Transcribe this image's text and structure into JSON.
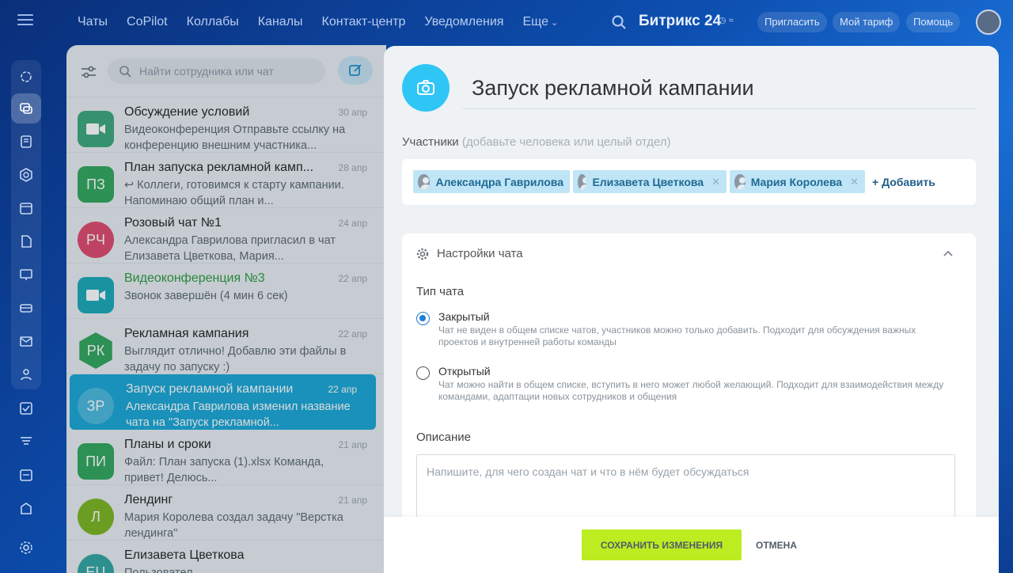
{
  "topbar": {
    "nav": [
      "Чаты",
      "CoPilot",
      "Коллабы",
      "Каналы",
      "Контакт-центр",
      "Уведомления",
      "Еще"
    ],
    "brand": "Битрикс 24",
    "buttons": [
      "Пригласить",
      "Мой тариф",
      "Помощь"
    ]
  },
  "rail": {
    "icons": [
      "copilot-icon",
      "chats-icon",
      "feed-icon",
      "collabs-icon",
      "calendar-icon",
      "documents-icon",
      "boards-icon",
      "drive-icon",
      "mail-icon",
      "groups-icon",
      "tasks-icon",
      "crm-icon",
      "planner-icon",
      "store-icon",
      "settings-icon"
    ]
  },
  "chatlist": {
    "search_placeholder": "Найти сотрудника или чат",
    "items": [
      {
        "title": "Обсуждение условий",
        "date": "30 апр",
        "text": "Видеоконференция Отправьте ссылку на конференцию внешним участника...",
        "ava": "",
        "color": "#3aa67a"
      },
      {
        "title": "План запуска рекламной камп...",
        "date": "28 апр",
        "text": "↩ Коллеги, готовимся к старту кампании. Напоминаю общий план и...",
        "ava": "ПЗ",
        "color": "#2fa55a"
      },
      {
        "title": "Розовый чат №1",
        "date": "24 апр",
        "text": "Александра Гаврилова пригласил в чат Елизавета Цветкова, Мария...",
        "ava": "РЧ",
        "color": "#e0476b"
      },
      {
        "title": "Видеоконференция №3",
        "date": "22 апр",
        "text": "Звонок завершён (4 мин 6 сек)",
        "ava": "",
        "color": "#18a9b8"
      },
      {
        "title": "Рекламная кампания",
        "date": "22 апр",
        "text": "Выглядит отлично! Добавлю эти файлы в задачу по запуску :)",
        "ava": "РК",
        "color": "#2fa55a"
      },
      {
        "title": "Запуск рекламной кампании",
        "date": "22 апр",
        "text": "Александра Гаврилова изменил название чата на \"Запуск рекламной...",
        "ava": "ЗР",
        "color": "#2f9ebf"
      },
      {
        "title": "Планы и сроки",
        "date": "21 апр",
        "text": "Файл: План запуска (1).xlsx Команда, привет! Делюсь...",
        "ava": "ПИ",
        "color": "#2fa55a"
      },
      {
        "title": "Лендинг",
        "date": "21 апр",
        "text": "Мария Королева создал задачу \"Верстка лендинга\"",
        "ava": "Л",
        "color": "#7ab51d"
      },
      {
        "title": "Елизавета Цветкова",
        "date": "",
        "text": "Пользовател...",
        "ava": "ЕЦ",
        "color": "#2fa5a0"
      }
    ]
  },
  "slider": {
    "title": "Запуск рекламной кампании",
    "participants_label": "Участники",
    "participants_hint": "(добавьте человека или целый отдел)",
    "participants": [
      "Александра Гаврилова",
      "Елизавета Цветкова",
      "Мария Королева"
    ],
    "add_label": "+ Добавить",
    "settings_title": "Настройки чата",
    "type_label": "Тип чата",
    "closed_title": "Закрытый",
    "closed_desc": "Чат не виден в общем списке чатов, участников можно только добавить. Подходит для обсуждения важных проектов и внутренней работы команды",
    "open_title": "Открытый",
    "open_desc": "Чат можно найти в общем списке, вступить в него может любой желающий. Подходит для взаимодействия между командами, адаптации новых сотрудников и общения",
    "selected_type": "closed",
    "description_label": "Описание",
    "description_placeholder": "Напишите, для чего создан чат и что в нём будет обсуждаться",
    "save_label": "СОХРАНИТЬ ИЗМЕНЕНИЯ",
    "cancel_label": "ОТМЕНА"
  },
  "colors": {
    "accent": "#2fc6f6",
    "save": "#bbed21",
    "active_chat": "#17a6d6"
  }
}
